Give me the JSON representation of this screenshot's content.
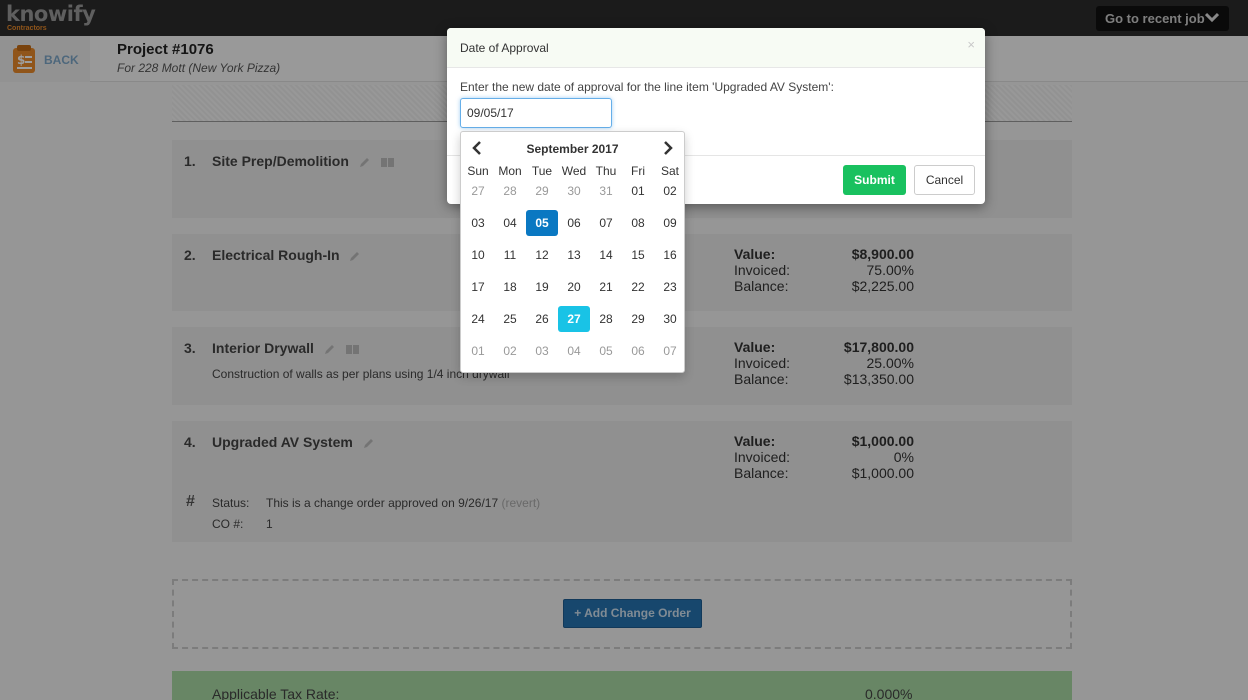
{
  "topbar": {
    "logo_text": "knowify",
    "logo_sub": "Contractors",
    "recent_label": "Go to recent job"
  },
  "header": {
    "back_label": "BACK",
    "project_title": "Project #1076",
    "project_subtitle": "For 228 Mott (New York Pizza)"
  },
  "line_items": [
    {
      "num": "1.",
      "title": "Site Prep/Demolition"
    },
    {
      "num": "2.",
      "title": "Electrical Rough-In",
      "value_label": "Value:",
      "value": "$8,900.00",
      "invoiced_label": "Invoiced:",
      "invoiced": "75.00%",
      "balance_label": "Balance:",
      "balance": "$2,225.00"
    },
    {
      "num": "3.",
      "title": "Interior Drywall",
      "description": "Construction of walls as per plans using 1/4 inch drywall",
      "value_label": "Value:",
      "value": "$17,800.00",
      "invoiced_label": "Invoiced:",
      "invoiced": "25.00%",
      "balance_label": "Balance:",
      "balance": "$13,350.00"
    },
    {
      "num": "4.",
      "title": "Upgraded AV System",
      "value_label": "Value:",
      "value": "$1,000.00",
      "invoiced_label": "Invoiced:",
      "invoiced": "0%",
      "balance_label": "Balance:",
      "balance": "$1,000.00",
      "hash": "#",
      "status_label": "Status:",
      "status_text": "This is a change order approved on 9/26/17",
      "revert": "(revert)",
      "co_label": "CO #:",
      "co_value": "1"
    }
  ],
  "add_change_order": "+ Add Change Order",
  "tax": {
    "label": "Applicable Tax Rate:",
    "value": "0.000%"
  },
  "modal": {
    "title": "Date of Approval",
    "close": "×",
    "prompt": "Enter the new date of approval for the line item 'Upgraded AV System':",
    "input_value": "09/05/17",
    "submit": "Submit",
    "cancel": "Cancel"
  },
  "datepicker": {
    "month_label": "September 2017",
    "weekdays": [
      "Sun",
      "Mon",
      "Tue",
      "Wed",
      "Thu",
      "Fri",
      "Sat"
    ],
    "weeks": [
      [
        [
          "27",
          "old"
        ],
        [
          "28",
          "old"
        ],
        [
          "29",
          "old"
        ],
        [
          "30",
          "old"
        ],
        [
          "31",
          "old"
        ],
        [
          "01",
          ""
        ],
        [
          "02",
          ""
        ]
      ],
      [
        [
          "03",
          ""
        ],
        [
          "04",
          ""
        ],
        [
          "05",
          "sel"
        ],
        [
          "06",
          ""
        ],
        [
          "07",
          ""
        ],
        [
          "08",
          ""
        ],
        [
          "09",
          ""
        ]
      ],
      [
        [
          "10",
          ""
        ],
        [
          "11",
          ""
        ],
        [
          "12",
          ""
        ],
        [
          "13",
          ""
        ],
        [
          "14",
          ""
        ],
        [
          "15",
          ""
        ],
        [
          "16",
          ""
        ]
      ],
      [
        [
          "17",
          ""
        ],
        [
          "18",
          ""
        ],
        [
          "19",
          ""
        ],
        [
          "20",
          ""
        ],
        [
          "21",
          ""
        ],
        [
          "22",
          ""
        ],
        [
          "23",
          ""
        ]
      ],
      [
        [
          "24",
          ""
        ],
        [
          "25",
          ""
        ],
        [
          "26",
          ""
        ],
        [
          "27",
          "today"
        ],
        [
          "28",
          ""
        ],
        [
          "29",
          ""
        ],
        [
          "30",
          ""
        ]
      ],
      [
        [
          "01",
          "old"
        ],
        [
          "02",
          "old"
        ],
        [
          "03",
          "old"
        ],
        [
          "04",
          "old"
        ],
        [
          "05",
          "old"
        ],
        [
          "06",
          "old"
        ],
        [
          "07",
          "old"
        ]
      ]
    ]
  },
  "colors": {
    "topbar": "#2d2d2d",
    "accent_blue": "#0a78c2",
    "today_cyan": "#19c3e6",
    "submit_green": "#19c15f",
    "tax_green": "#a8d8a3"
  }
}
